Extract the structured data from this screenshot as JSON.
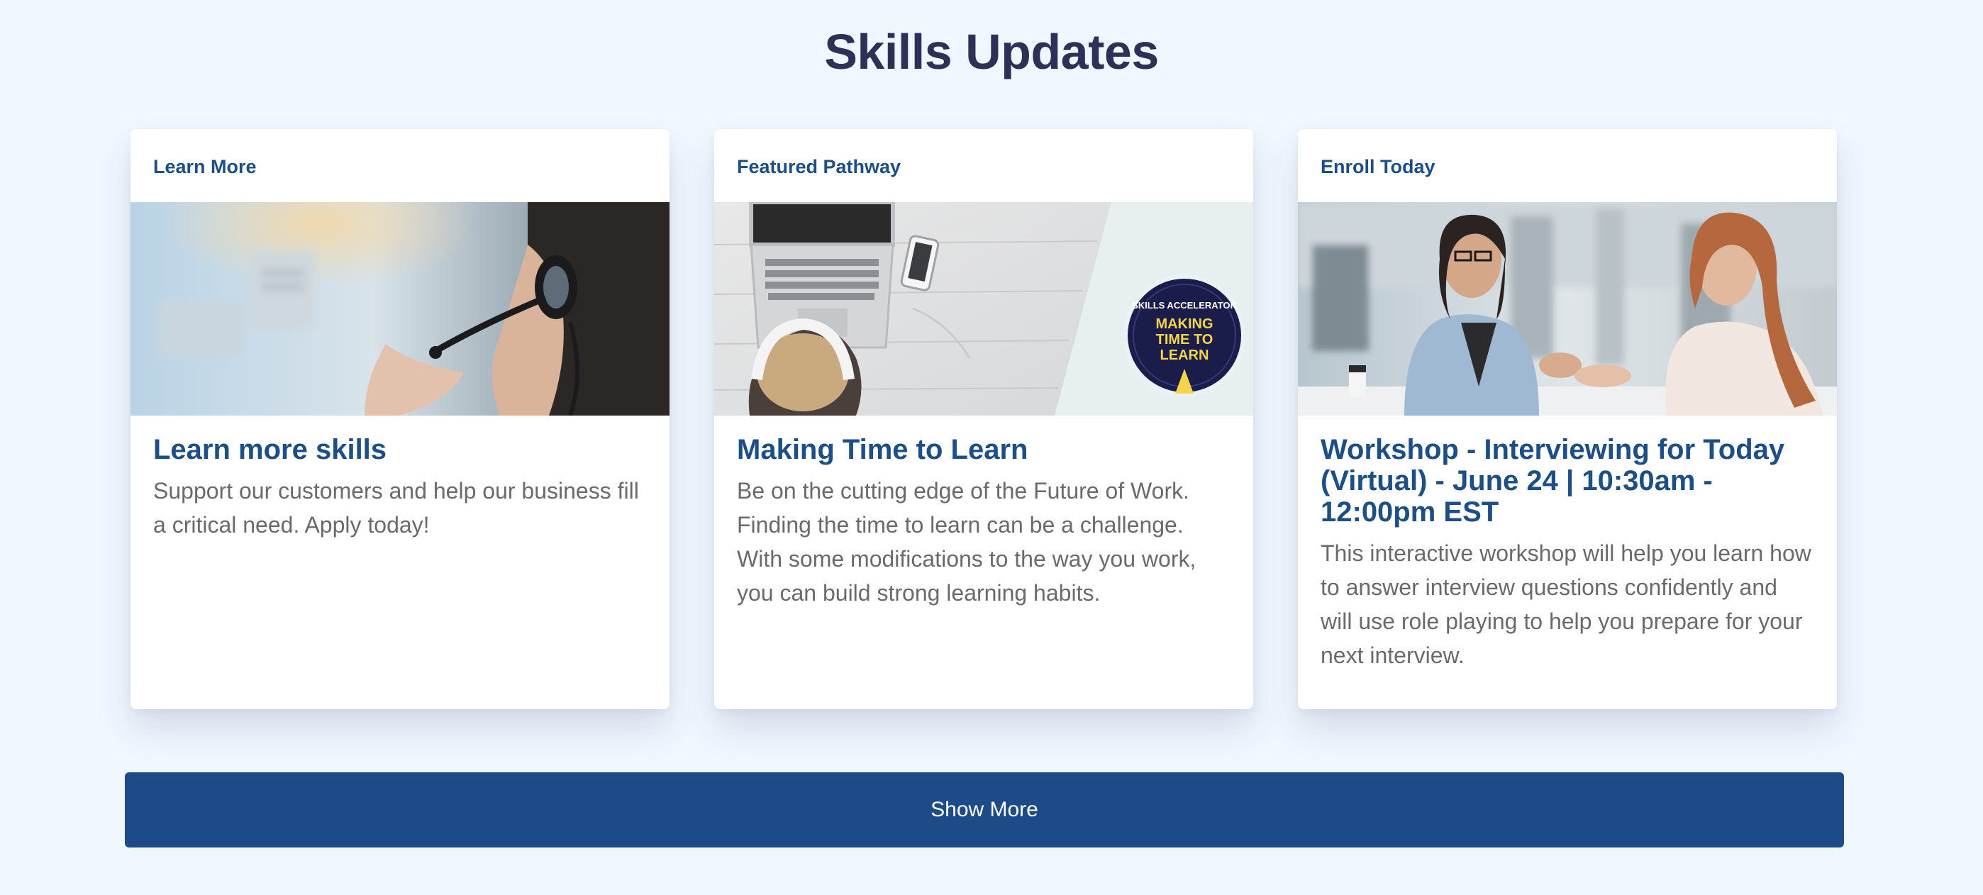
{
  "section": {
    "title": "Skills Updates"
  },
  "cards": [
    {
      "eyebrow": "Learn More",
      "image_alt": "Customer service agent wearing a headset",
      "title": "Learn more skills",
      "text": "Support our customers and help our business fill a critical need. Apply today!"
    },
    {
      "eyebrow": "Featured Pathway",
      "image_alt": "Person with headphones at a laptop, Skills Accelerator badge",
      "badge": {
        "ring_text": "SKILLS ACCELERATOR",
        "line1": "MAKING",
        "line2": "TIME TO",
        "line3": "LEARN"
      },
      "title": "Making Time to Learn",
      "text": "Be on the cutting edge of the Future of Work. Finding the time to learn can be a challenge. With some modifications to the way you work, you can build strong learning habits."
    },
    {
      "eyebrow": "Enroll Today",
      "image_alt": "Two women talking in an office",
      "title": "Workshop - Interviewing for Today (Virtual) - June 24 | 10:30am - 12:00pm EST",
      "text": "This interactive workshop will help you learn how to answer interview questions confidently and will use role playing to help you prepare for your next interview."
    }
  ],
  "actions": {
    "show_more_label": "Show More"
  },
  "colors": {
    "page_background": "#f0f7fe",
    "heading": "#2e3057",
    "card_accent": "#1d4f86",
    "body_text": "#6a6a6a",
    "button_background": "#1c4b87"
  }
}
